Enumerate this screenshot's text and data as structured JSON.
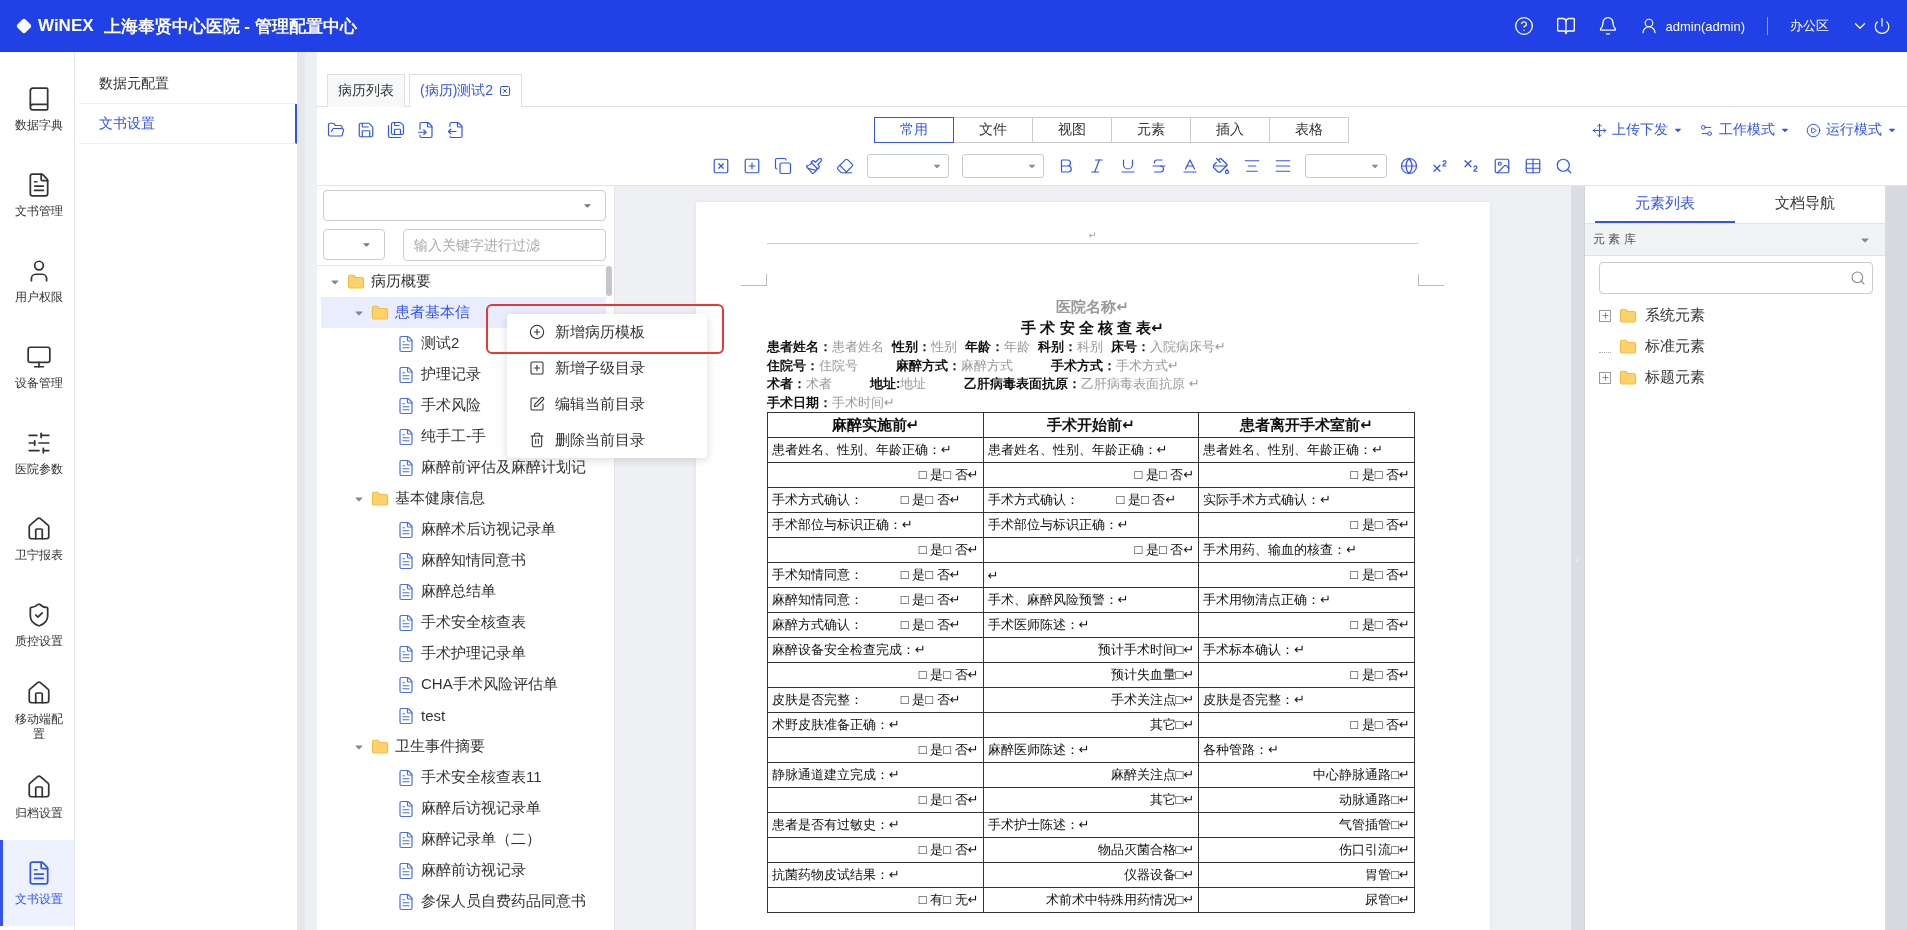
{
  "header": {
    "logo": "WiNEX",
    "title": "上海奉贤中心医院 - 管理配置中心",
    "user": "admin(admin)",
    "area": "办公区"
  },
  "nav": [
    {
      "label": "数据字典",
      "selected": false
    },
    {
      "label": "文书管理",
      "selected": false
    },
    {
      "label": "用户权限",
      "selected": false
    },
    {
      "label": "设备管理",
      "selected": false
    },
    {
      "label": "医院参数",
      "selected": false
    },
    {
      "label": "卫宁报表",
      "selected": false
    },
    {
      "label": "质控设置",
      "selected": false
    },
    {
      "label": "移动端配置",
      "selected": false
    },
    {
      "label": "归档设置",
      "selected": false
    },
    {
      "label": "文书设置",
      "selected": true
    }
  ],
  "subnav": [
    {
      "label": "数据元配置",
      "selected": false
    },
    {
      "label": "文书设置",
      "selected": true
    }
  ],
  "tabs": [
    {
      "label": "病历列表",
      "selected": false,
      "closable": false
    },
    {
      "label": "(病历)测试2",
      "selected": true,
      "closable": true
    }
  ],
  "ribbon_tabs": [
    {
      "label": "常用",
      "selected": true
    },
    {
      "label": "文件",
      "selected": false
    },
    {
      "label": "视图",
      "selected": false
    },
    {
      "label": "元素",
      "selected": false
    },
    {
      "label": "插入",
      "selected": false
    },
    {
      "label": "表格",
      "selected": false
    }
  ],
  "modes": [
    "上传下发",
    "工作模式",
    "运行模式"
  ],
  "tree": {
    "filter_placeholder": "输入关键字进行过滤",
    "items": [
      {
        "label": "病历概要",
        "kind": "folder",
        "expanded": true,
        "selected": false,
        "children": [
          {
            "label": "患者基本信",
            "kind": "folder",
            "expanded": true,
            "selected": true,
            "children": [
              {
                "label": "测试2",
                "kind": "document",
                "selected": false
              },
              {
                "label": "护理记录",
                "kind": "document",
                "selected": false
              },
              {
                "label": "手术风险",
                "kind": "document",
                "selected": false
              },
              {
                "label": "纯手工-手",
                "kind": "document",
                "selected": false
              },
              {
                "label": "麻醉前评估及麻醉计划记",
                "kind": "document",
                "selected": false
              }
            ]
          },
          {
            "label": "基本健康信息",
            "kind": "folder",
            "expanded": true,
            "selected": false,
            "children": [
              {
                "label": "麻醉术后访视记录单",
                "kind": "document",
                "selected": false
              },
              {
                "label": "麻醉知情同意书",
                "kind": "document",
                "selected": false
              },
              {
                "label": "麻醉总结单",
                "kind": "document",
                "selected": false
              },
              {
                "label": "手术安全核查表",
                "kind": "document",
                "selected": false
              },
              {
                "label": "手术护理记录单",
                "kind": "document",
                "selected": false
              },
              {
                "label": "CHA手术风险评估单",
                "kind": "document",
                "selected": false
              },
              {
                "label": "test",
                "kind": "document",
                "selected": false
              }
            ]
          },
          {
            "label": "卫生事件摘要",
            "kind": "folder",
            "expanded": true,
            "selected": false,
            "children": [
              {
                "label": "手术安全核查表11",
                "kind": "document",
                "selected": false
              },
              {
                "label": "麻醉后访视记录单",
                "kind": "document",
                "selected": false
              },
              {
                "label": "麻醉记录单（二）",
                "kind": "document",
                "selected": false
              },
              {
                "label": "麻醉前访视记录",
                "kind": "document",
                "selected": false
              },
              {
                "label": "参保人员自费药品同意书",
                "kind": "document",
                "selected": false
              }
            ]
          }
        ]
      }
    ]
  },
  "context_menu": [
    {
      "label": "新增病历模板",
      "highlighted": true
    },
    {
      "label": "新增子级目录",
      "highlighted": false
    },
    {
      "label": "编辑当前目录",
      "highlighted": false
    },
    {
      "label": "删除当前目录",
      "highlighted": false
    }
  ],
  "document": {
    "header_mark": "↵",
    "hospital": "医院名称↵",
    "title": "手 术 安 全 核 查 表↵",
    "info_lines": [
      [
        {
          "label": "患者姓名：",
          "value": "患者姓名"
        },
        {
          "label": "性别：",
          "value": "性别"
        },
        {
          "label": "年龄：",
          "value": "年龄"
        },
        {
          "label": "科别：",
          "value": "科别"
        },
        {
          "label": "床号：",
          "value": "入院病床号↵"
        }
      ],
      [
        {
          "label": "住院号：",
          "value": "住院号"
        },
        {
          "label": "麻醉方式：",
          "value": "麻醉方式"
        },
        {
          "label": "手术方式：",
          "value": "手术方式↵"
        }
      ],
      [
        {
          "label": "术者：",
          "value": "术者"
        },
        {
          "label": "地址:",
          "value": "地址"
        },
        {
          "label": "乙肝病毒表面抗原：",
          "value": "乙肝病毒表面抗原 ↵"
        }
      ],
      [
        {
          "label": "手术日期：",
          "value": "手术时间↵"
        }
      ]
    ],
    "columns": [
      "麻醉实施前↵",
      "手术开始前↵",
      "患者离开手术室前↵"
    ],
    "rows": [
      [
        {
          "kind": "label",
          "text": "患者姓名、性别、年龄正确：↵"
        },
        {
          "kind": "label",
          "text": "患者姓名、性别、年龄正确：↵"
        },
        {
          "kind": "label",
          "text": "患者姓名、性别、年龄正确：↵"
        }
      ],
      [
        {
          "kind": "choice",
          "text": "□ 是□ 否↵"
        },
        {
          "kind": "choice",
          "text": "□ 是□ 否↵"
        },
        {
          "kind": "choice",
          "text": "□ 是□ 否↵"
        }
      ],
      [
        {
          "kind": "pair",
          "text": "手术方式确认：",
          "answer": "□ 是□ 否↵"
        },
        {
          "kind": "pair",
          "text": "手术方式确认：",
          "answer": "□ 是□ 否↵"
        },
        {
          "kind": "label",
          "text": "实际手术方式确认：↵"
        }
      ],
      [
        {
          "kind": "label",
          "text": "手术部位与标识正确：↵"
        },
        {
          "kind": "label",
          "text": "手术部位与标识正确：↵"
        },
        {
          "kind": "choice",
          "text": "□ 是□ 否↵"
        }
      ],
      [
        {
          "kind": "choice",
          "text": "□ 是□ 否↵"
        },
        {
          "kind": "choice",
          "text": "□ 是□ 否↵"
        },
        {
          "kind": "label",
          "text": "手术用药、输血的核查：↵"
        }
      ],
      [
        {
          "kind": "pair",
          "text": "手术知情同意：",
          "answer": "□ 是□ 否↵"
        },
        {
          "kind": "label",
          "text": "↵"
        },
        {
          "kind": "choice",
          "text": "□ 是□ 否↵"
        }
      ],
      [
        {
          "kind": "pair",
          "text": "麻醉知情同意：",
          "answer": "□ 是□ 否↵"
        },
        {
          "kind": "label",
          "text": "手术、麻醉风险预警：↵"
        },
        {
          "kind": "label",
          "text": "手术用物清点正确：↵"
        }
      ],
      [
        {
          "kind": "pair",
          "text": "麻醉方式确认：",
          "answer": "□ 是□ 否↵"
        },
        {
          "kind": "label",
          "text": "手术医师陈述：↵"
        },
        {
          "kind": "choice",
          "text": "□ 是□ 否↵"
        }
      ],
      [
        {
          "kind": "label",
          "text": "麻醉设备安全检查完成：↵"
        },
        {
          "kind": "choice",
          "text": "预计手术时间□↵"
        },
        {
          "kind": "label",
          "text": "手术标本确认：↵"
        }
      ],
      [
        {
          "kind": "choice",
          "text": "□ 是□ 否↵"
        },
        {
          "kind": "choice",
          "text": "预计失血量□↵"
        },
        {
          "kind": "choice",
          "text": "□ 是□ 否↵"
        }
      ],
      [
        {
          "kind": "pair",
          "text": "皮肤是否完整：",
          "answer": "□ 是□ 否↵"
        },
        {
          "kind": "choice",
          "text": "手术关注点□↵"
        },
        {
          "kind": "label",
          "text": "皮肤是否完整：↵"
        }
      ],
      [
        {
          "kind": "label",
          "text": "术野皮肤准备正确：↵"
        },
        {
          "kind": "choice",
          "text": "其它□↵"
        },
        {
          "kind": "choice",
          "text": "□ 是□ 否↵"
        }
      ],
      [
        {
          "kind": "choice",
          "text": "□ 是□ 否↵"
        },
        {
          "kind": "label",
          "text": "麻醉医师陈述：↵"
        },
        {
          "kind": "label",
          "text": "各种管路：↵"
        }
      ],
      [
        {
          "kind": "label",
          "text": "静脉通道建立完成：↵"
        },
        {
          "kind": "choice",
          "text": "麻醉关注点□↵"
        },
        {
          "kind": "choice",
          "text": "中心静脉通路□↵"
        }
      ],
      [
        {
          "kind": "choice",
          "text": "□ 是□ 否↵"
        },
        {
          "kind": "choice",
          "text": "其它□↵"
        },
        {
          "kind": "choice",
          "text": "动脉通路□↵"
        }
      ],
      [
        {
          "kind": "label",
          "text": "患者是否有过敏史：↵"
        },
        {
          "kind": "label",
          "text": "手术护士陈述：↵"
        },
        {
          "kind": "choice",
          "text": "气管插管□↵"
        }
      ],
      [
        {
          "kind": "choice",
          "text": "□ 是□ 否↵"
        },
        {
          "kind": "choice",
          "text": "物品灭菌合格□↵"
        },
        {
          "kind": "choice",
          "text": "伤口引流□↵"
        }
      ],
      [
        {
          "kind": "label",
          "text": "抗菌药物皮试结果：↵"
        },
        {
          "kind": "choice",
          "text": "仪器设备□↵"
        },
        {
          "kind": "choice",
          "text": "胃管□↵"
        }
      ],
      [
        {
          "kind": "choice",
          "text": "□ 有□ 无↵"
        },
        {
          "kind": "choice",
          "text": "术前术中特殊用药情况□↵"
        },
        {
          "kind": "choice",
          "text": "尿管□↵"
        }
      ]
    ]
  },
  "right_panel": {
    "tabs": [
      {
        "label": "元素列表",
        "selected": true
      },
      {
        "label": "文档导航",
        "selected": false
      }
    ],
    "library": "元 素 库",
    "items": [
      {
        "label": "系统元素",
        "expandable": true
      },
      {
        "label": "标准元素",
        "expandable": false
      },
      {
        "label": "标题元素",
        "expandable": true
      }
    ]
  }
}
